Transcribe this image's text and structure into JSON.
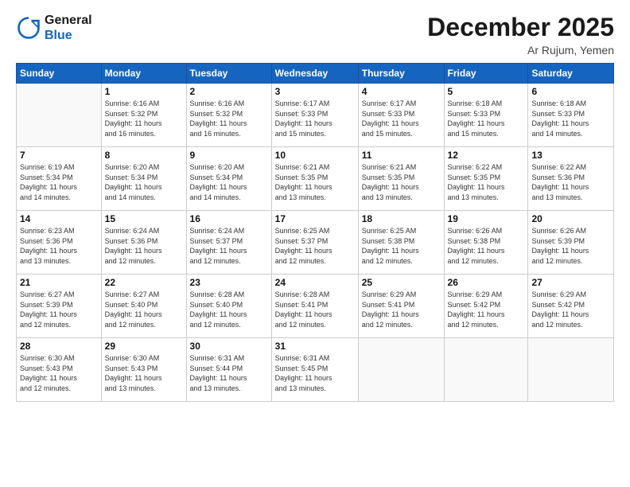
{
  "header": {
    "logo_line1": "General",
    "logo_line2": "Blue",
    "month": "December 2025",
    "location": "Ar Rujum, Yemen"
  },
  "weekdays": [
    "Sunday",
    "Monday",
    "Tuesday",
    "Wednesday",
    "Thursday",
    "Friday",
    "Saturday"
  ],
  "weeks": [
    [
      {
        "day": "",
        "info": ""
      },
      {
        "day": "1",
        "info": "Sunrise: 6:16 AM\nSunset: 5:32 PM\nDaylight: 11 hours\nand 16 minutes."
      },
      {
        "day": "2",
        "info": "Sunrise: 6:16 AM\nSunset: 5:32 PM\nDaylight: 11 hours\nand 16 minutes."
      },
      {
        "day": "3",
        "info": "Sunrise: 6:17 AM\nSunset: 5:33 PM\nDaylight: 11 hours\nand 15 minutes."
      },
      {
        "day": "4",
        "info": "Sunrise: 6:17 AM\nSunset: 5:33 PM\nDaylight: 11 hours\nand 15 minutes."
      },
      {
        "day": "5",
        "info": "Sunrise: 6:18 AM\nSunset: 5:33 PM\nDaylight: 11 hours\nand 15 minutes."
      },
      {
        "day": "6",
        "info": "Sunrise: 6:18 AM\nSunset: 5:33 PM\nDaylight: 11 hours\nand 14 minutes."
      }
    ],
    [
      {
        "day": "7",
        "info": "Sunrise: 6:19 AM\nSunset: 5:34 PM\nDaylight: 11 hours\nand 14 minutes."
      },
      {
        "day": "8",
        "info": "Sunrise: 6:20 AM\nSunset: 5:34 PM\nDaylight: 11 hours\nand 14 minutes."
      },
      {
        "day": "9",
        "info": "Sunrise: 6:20 AM\nSunset: 5:34 PM\nDaylight: 11 hours\nand 14 minutes."
      },
      {
        "day": "10",
        "info": "Sunrise: 6:21 AM\nSunset: 5:35 PM\nDaylight: 11 hours\nand 13 minutes."
      },
      {
        "day": "11",
        "info": "Sunrise: 6:21 AM\nSunset: 5:35 PM\nDaylight: 11 hours\nand 13 minutes."
      },
      {
        "day": "12",
        "info": "Sunrise: 6:22 AM\nSunset: 5:35 PM\nDaylight: 11 hours\nand 13 minutes."
      },
      {
        "day": "13",
        "info": "Sunrise: 6:22 AM\nSunset: 5:36 PM\nDaylight: 11 hours\nand 13 minutes."
      }
    ],
    [
      {
        "day": "14",
        "info": "Sunrise: 6:23 AM\nSunset: 5:36 PM\nDaylight: 11 hours\nand 13 minutes."
      },
      {
        "day": "15",
        "info": "Sunrise: 6:24 AM\nSunset: 5:36 PM\nDaylight: 11 hours\nand 12 minutes."
      },
      {
        "day": "16",
        "info": "Sunrise: 6:24 AM\nSunset: 5:37 PM\nDaylight: 11 hours\nand 12 minutes."
      },
      {
        "day": "17",
        "info": "Sunrise: 6:25 AM\nSunset: 5:37 PM\nDaylight: 11 hours\nand 12 minutes."
      },
      {
        "day": "18",
        "info": "Sunrise: 6:25 AM\nSunset: 5:38 PM\nDaylight: 11 hours\nand 12 minutes."
      },
      {
        "day": "19",
        "info": "Sunrise: 6:26 AM\nSunset: 5:38 PM\nDaylight: 11 hours\nand 12 minutes."
      },
      {
        "day": "20",
        "info": "Sunrise: 6:26 AM\nSunset: 5:39 PM\nDaylight: 11 hours\nand 12 minutes."
      }
    ],
    [
      {
        "day": "21",
        "info": "Sunrise: 6:27 AM\nSunset: 5:39 PM\nDaylight: 11 hours\nand 12 minutes."
      },
      {
        "day": "22",
        "info": "Sunrise: 6:27 AM\nSunset: 5:40 PM\nDaylight: 11 hours\nand 12 minutes."
      },
      {
        "day": "23",
        "info": "Sunrise: 6:28 AM\nSunset: 5:40 PM\nDaylight: 11 hours\nand 12 minutes."
      },
      {
        "day": "24",
        "info": "Sunrise: 6:28 AM\nSunset: 5:41 PM\nDaylight: 11 hours\nand 12 minutes."
      },
      {
        "day": "25",
        "info": "Sunrise: 6:29 AM\nSunset: 5:41 PM\nDaylight: 11 hours\nand 12 minutes."
      },
      {
        "day": "26",
        "info": "Sunrise: 6:29 AM\nSunset: 5:42 PM\nDaylight: 11 hours\nand 12 minutes."
      },
      {
        "day": "27",
        "info": "Sunrise: 6:29 AM\nSunset: 5:42 PM\nDaylight: 11 hours\nand 12 minutes."
      }
    ],
    [
      {
        "day": "28",
        "info": "Sunrise: 6:30 AM\nSunset: 5:43 PM\nDaylight: 11 hours\nand 12 minutes."
      },
      {
        "day": "29",
        "info": "Sunrise: 6:30 AM\nSunset: 5:43 PM\nDaylight: 11 hours\nand 13 minutes."
      },
      {
        "day": "30",
        "info": "Sunrise: 6:31 AM\nSunset: 5:44 PM\nDaylight: 11 hours\nand 13 minutes."
      },
      {
        "day": "31",
        "info": "Sunrise: 6:31 AM\nSunset: 5:45 PM\nDaylight: 11 hours\nand 13 minutes."
      },
      {
        "day": "",
        "info": ""
      },
      {
        "day": "",
        "info": ""
      },
      {
        "day": "",
        "info": ""
      }
    ]
  ]
}
